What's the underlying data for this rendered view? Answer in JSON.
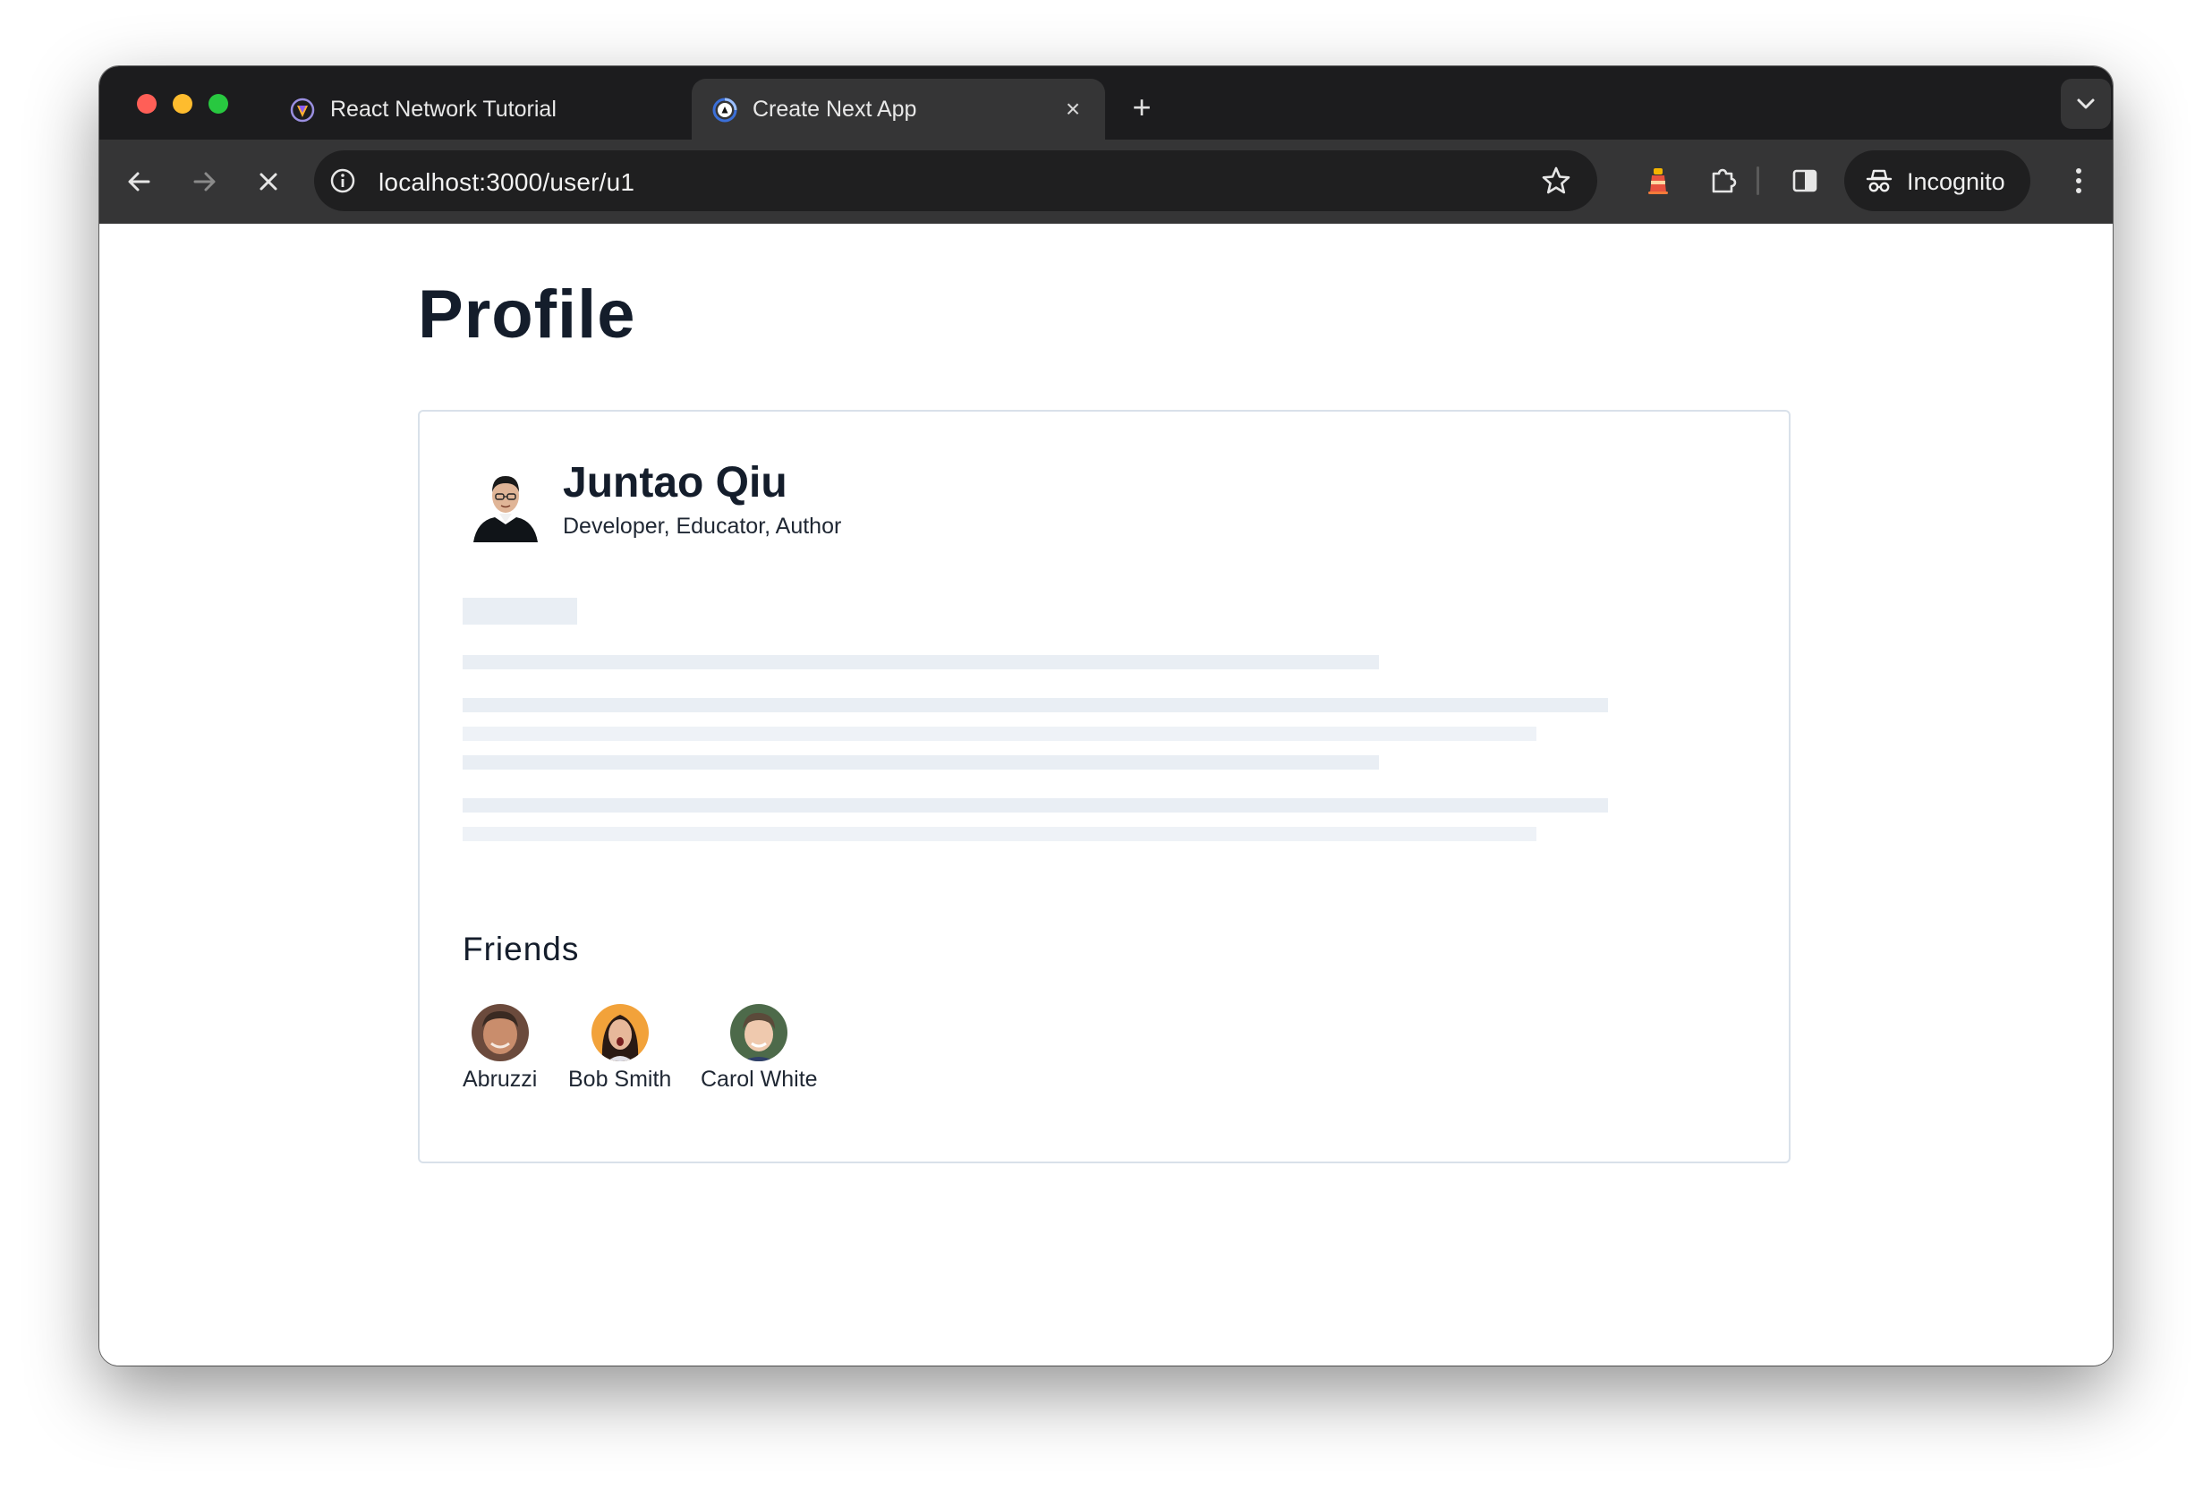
{
  "browser": {
    "tabs": [
      {
        "title": "React Network Tutorial",
        "active": false
      },
      {
        "title": "Create Next App",
        "active": true
      }
    ],
    "close_glyph": "×",
    "new_tab_glyph": "+",
    "address": "localhost:3000/user/u1",
    "incognito_label": "Incognito"
  },
  "page": {
    "title": "Profile",
    "profile": {
      "name": "Juntao Qiu",
      "bio": "Developer, Educator, Author"
    },
    "friends_heading": "Friends",
    "friends": [
      {
        "name": "Abruzzi"
      },
      {
        "name": "Bob Smith"
      },
      {
        "name": "Carol White"
      }
    ]
  },
  "colors": {
    "tab_strip": "#1c1c1e",
    "toolbar": "#353536",
    "skeleton": "#e9eef4",
    "card_border": "#d9e1ea",
    "heading_text": "#141d2b"
  }
}
